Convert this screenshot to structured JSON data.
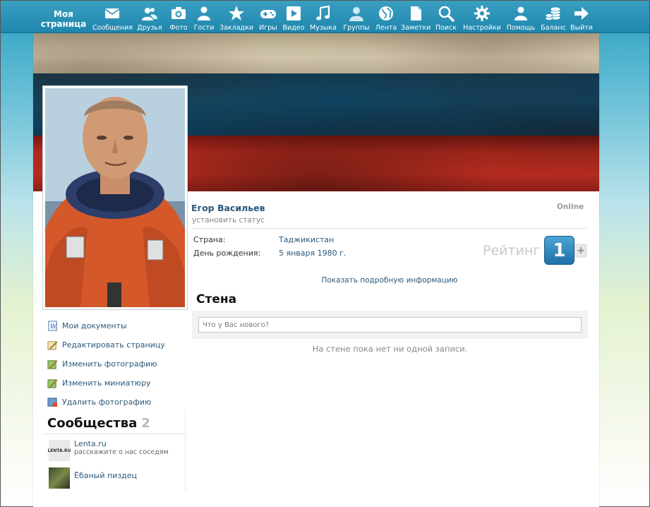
{
  "header": {
    "my_page": "Моя страница",
    "nav": [
      {
        "label": "Сообщения",
        "icon": "envelope-icon"
      },
      {
        "label": "Друзья",
        "icon": "friends-icon"
      },
      {
        "label": "Фото",
        "icon": "camera-icon"
      },
      {
        "label": "Гости",
        "icon": "guest-icon"
      },
      {
        "label": "Закладки",
        "icon": "star-icon"
      },
      {
        "label": "Игры",
        "icon": "gamepad-icon"
      },
      {
        "label": "Видео",
        "icon": "play-icon"
      },
      {
        "label": "Музыка",
        "icon": "music-note-icon"
      },
      {
        "label": "Группы",
        "icon": "groups-icon"
      },
      {
        "label": "Лента",
        "icon": "globe-icon"
      },
      {
        "label": "Заметки",
        "icon": "document-icon"
      },
      {
        "label": "Поиск",
        "icon": "magnifier-icon"
      },
      {
        "label": "Настройки",
        "icon": "gear-icon"
      },
      {
        "label": "Помощь",
        "icon": "help-person-icon"
      },
      {
        "label": "Баланс",
        "icon": "coins-icon"
      },
      {
        "label": "Выйти",
        "icon": "arrow-right-icon"
      }
    ]
  },
  "profile": {
    "name": "Егор Васильев",
    "status_placeholder": "установить статус",
    "online": "Online",
    "country_label": "Страна:",
    "country_value": "Таджикистан",
    "birthday_label": "День рождения:",
    "birthday_value": "5 января 1980 г.",
    "rating_label": "Рейтинг",
    "rating_value": "1",
    "rating_plus": "+",
    "more_info": "Показать подробную информацию"
  },
  "menu": [
    {
      "label": "Мои документы",
      "icon": "documents-icon"
    },
    {
      "label": "Редактировать страницу",
      "icon": "edit-page-icon"
    },
    {
      "label": "Изменить фотографию",
      "icon": "edit-photo-icon"
    },
    {
      "label": "Изменить миниатюру",
      "icon": "edit-thumbnail-icon"
    },
    {
      "label": "Удалить фотографию",
      "icon": "delete-photo-icon"
    }
  ],
  "communities": {
    "title": "Сообщества",
    "count": "2",
    "items": [
      {
        "name": "Lenta.ru",
        "desc": "расскажите о нас соседям",
        "thumb_text": "LENTA.RU"
      },
      {
        "name": "Ёбаный пиздец",
        "desc": ""
      }
    ]
  },
  "wall": {
    "title": "Стена",
    "input_placeholder": "Что у Вас нового?",
    "empty_text": "На стене пока нет ни одной записи."
  }
}
